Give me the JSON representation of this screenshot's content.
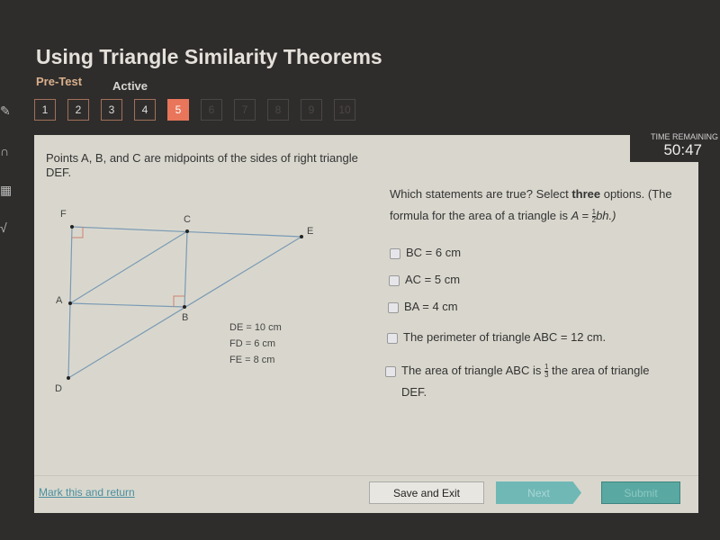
{
  "header": {
    "title": "Using Triangle Similarity Theorems",
    "mode": "Pre-Test",
    "status": "Active"
  },
  "questions": {
    "numbers": [
      "1",
      "2",
      "3",
      "4",
      "5",
      "6",
      "7",
      "8",
      "9",
      "10"
    ],
    "current": "5"
  },
  "timer": {
    "label": "TIME REMAINING",
    "value": "50:47"
  },
  "problem": {
    "prompt": "Points A, B, and C are midpoints of the sides of right triangle DEF.",
    "points": {
      "F": "F",
      "C": "C",
      "E": "E",
      "A": "A",
      "B": "B",
      "D": "D"
    },
    "measurements": [
      "DE = 10 cm",
      "FD = 6 cm",
      "FE = 8 cm"
    ]
  },
  "question": {
    "text_before": "Which statements are true? Select ",
    "emphasis": "three",
    "text_after": " options. (The formula for the area of a triangle is ",
    "formula_a": "A = ",
    "half_num": "1",
    "half_den": "2",
    "formula_b": "bh.)"
  },
  "options": [
    {
      "label": "BC = 6 cm",
      "checked": false
    },
    {
      "label": "AC = 5 cm",
      "checked": false
    },
    {
      "label": "BA = 4 cm",
      "checked": false
    },
    {
      "label": "The perimeter of triangle ABC  = 12 cm.",
      "checked": false
    },
    {
      "label_a": "The area of triangle ABC is ",
      "num": "1",
      "den": "3",
      "label_b": " the area of triangle DEF.",
      "checked": false
    }
  ],
  "footer": {
    "mark": "Mark this and return",
    "save": "Save and Exit",
    "next": "Next",
    "submit": "Submit"
  }
}
